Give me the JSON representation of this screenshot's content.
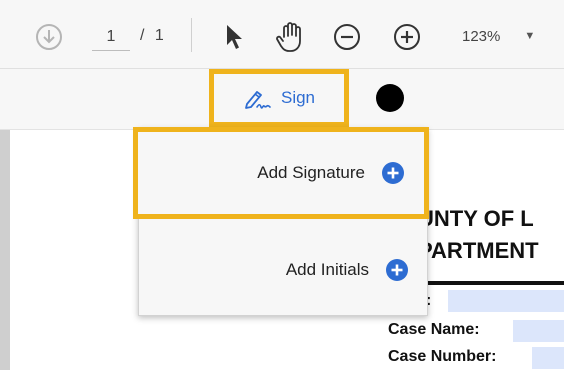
{
  "toolbar": {
    "page_current": "1",
    "page_separator": "/",
    "page_total": "1",
    "zoom_value": "123%",
    "icons": [
      "download-arrow-icon",
      "cursor-arrow-icon",
      "hand-icon",
      "zoom-out-icon",
      "zoom-in-icon",
      "dropdown-caret-icon"
    ]
  },
  "sign_bar": {
    "sign_label": "Sign",
    "ink_color": "#000000",
    "accent_color": "#2d6cd2",
    "highlight_color": "#efb31c"
  },
  "sign_menu": {
    "items": [
      {
        "label": "Add Signature"
      },
      {
        "label": "Add Initials"
      }
    ]
  },
  "document": {
    "heading_line1": "UNTY OF L",
    "heading_line2": "PARTMENT",
    "field_label_partial": ":",
    "case_name_label": "Case Name:",
    "case_number_label": "Case Number:"
  }
}
